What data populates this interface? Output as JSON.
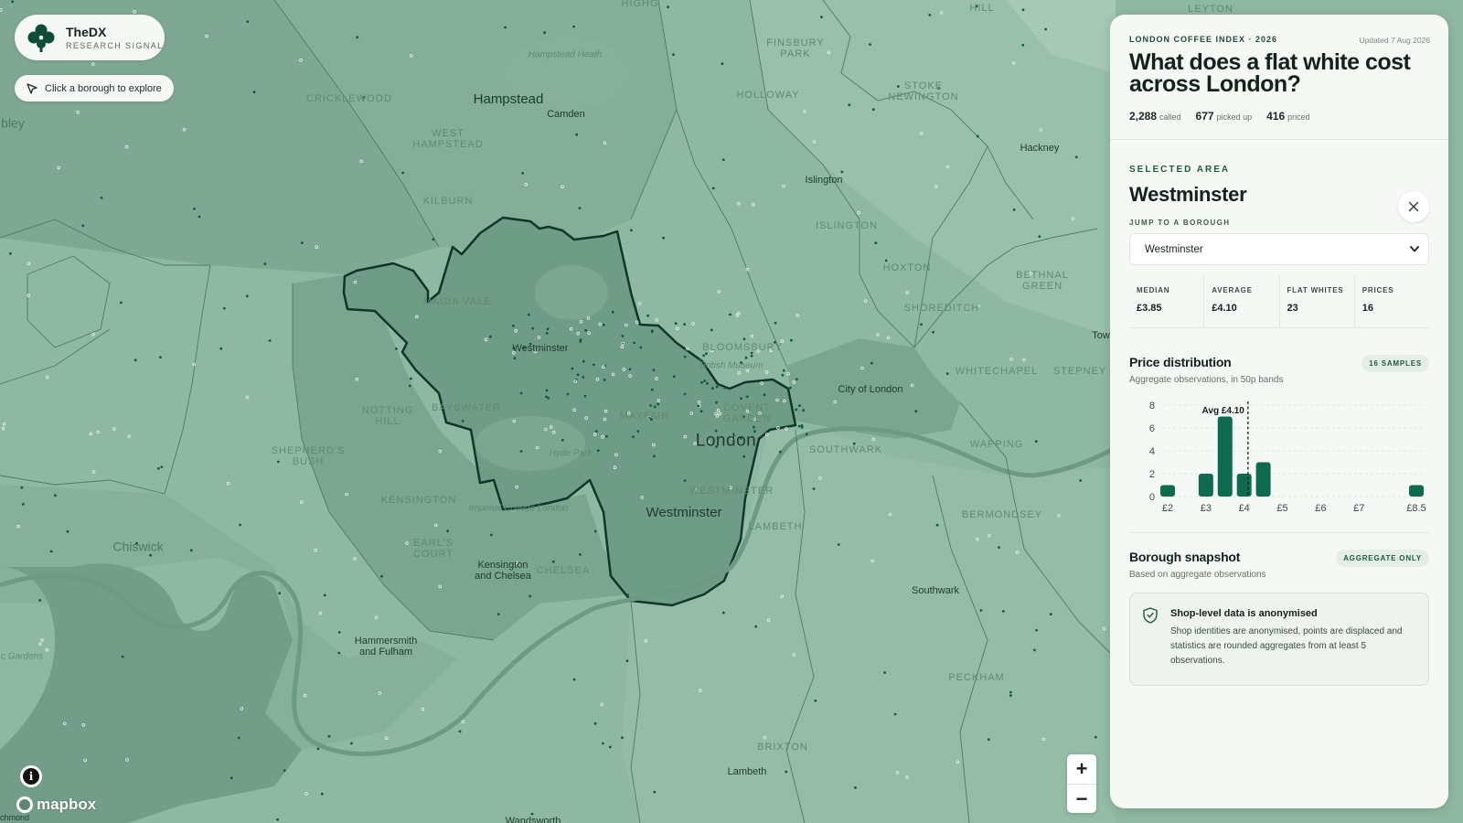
{
  "brand": {
    "name": "TheDX",
    "tagline": "RESEARCH SIGNAL"
  },
  "hint": "Click a borough to explore",
  "map": {
    "attribution": "mapbox",
    "zoom_in": "+",
    "zoom_out": "−",
    "info": "i",
    "corner_place": "chmond",
    "labels": [
      {
        "text": "Hampstead",
        "style": "med"
      },
      {
        "text": "Camden",
        "style": ""
      },
      {
        "text": "Hackney",
        "style": ""
      },
      {
        "text": "Islington",
        "style": ""
      },
      {
        "text": "Westminster",
        "style": ""
      },
      {
        "text": "City of London",
        "style": ""
      },
      {
        "text": "London",
        "style": "big"
      },
      {
        "text": "Westminster",
        "style": "med"
      },
      {
        "text": "Chiswick",
        "style": "large-faint"
      },
      {
        "text": "Kensington\nand Chelsea",
        "style": ""
      },
      {
        "text": "Hammersmith\nand Fulham",
        "style": ""
      },
      {
        "text": "Southwark",
        "style": ""
      },
      {
        "text": "Lambeth",
        "style": ""
      },
      {
        "text": "Wandsworth",
        "style": ""
      },
      {
        "text": "Tow",
        "style": ""
      },
      {
        "text": "bley",
        "style": "large-faint"
      },
      {
        "text": "HIGHG",
        "style": "faint"
      },
      {
        "text": "HILL",
        "style": "faint"
      },
      {
        "text": "LEYTON",
        "style": "faint"
      },
      {
        "text": "FINSBURY\nPARK",
        "style": "faint"
      },
      {
        "text": "STOKE\nNEWINGTON",
        "style": "faint"
      },
      {
        "text": "HOLLOWAY",
        "style": "faint"
      },
      {
        "text": "CRICKLEWOOD",
        "style": "faint"
      },
      {
        "text": "WEST\nHAMPSTEAD",
        "style": "faint"
      },
      {
        "text": "KILBURN",
        "style": "faint"
      },
      {
        "text": "ISLINGTON",
        "style": "faint"
      },
      {
        "text": "HOXTON",
        "style": "faint"
      },
      {
        "text": "BETHNAL\nGREEN",
        "style": "faint"
      },
      {
        "text": "SHOREDITCH",
        "style": "faint"
      },
      {
        "text": "MAIDA VALE",
        "style": "faint"
      },
      {
        "text": "BLOOMSBURY",
        "style": "faint"
      },
      {
        "text": "BAYSWATER",
        "style": "faint"
      },
      {
        "text": "NOTTING\nHILL",
        "style": "faint"
      },
      {
        "text": "MAYFAIR",
        "style": "faint"
      },
      {
        "text": "COVENT\nGARDEN",
        "style": "faint"
      },
      {
        "text": "WHITECHAPEL",
        "style": "faint"
      },
      {
        "text": "STEPNEY",
        "style": "faint"
      },
      {
        "text": "SOUTHWARK",
        "style": "faint"
      },
      {
        "text": "WAPPING",
        "style": "faint"
      },
      {
        "text": "SHEPHERD'S\nBUSH",
        "style": "faint"
      },
      {
        "text": "KENSINGTON",
        "style": "faint"
      },
      {
        "text": "EARL'S\nCOURT",
        "style": "faint"
      },
      {
        "text": "CHELSEA",
        "style": "faint"
      },
      {
        "text": "WESTMINSTER",
        "style": "faint"
      },
      {
        "text": "LAMBETH",
        "style": "faint"
      },
      {
        "text": "BERMONDSEY",
        "style": "faint"
      },
      {
        "text": "PECKHAM",
        "style": "faint"
      },
      {
        "text": "BRIXTON",
        "style": "faint"
      },
      {
        "text": "Hampstead Heath",
        "style": "faint-lc"
      },
      {
        "text": "Hyde Park",
        "style": "faint-lc"
      },
      {
        "text": "Imperial College London",
        "style": "faint-lc"
      },
      {
        "text": "British Museum",
        "style": "faint-lc"
      },
      {
        "text": "c Gardens",
        "style": "faint-lc"
      }
    ]
  },
  "panel": {
    "kicker": "LONDON COFFEE INDEX · 2026",
    "updated": "Updated 7 Aug 2026",
    "headline": "What does a flat white cost across London?",
    "stats": [
      {
        "value": "2,288",
        "label": "called"
      },
      {
        "value": "677",
        "label": "picked up"
      },
      {
        "value": "416",
        "label": "priced"
      }
    ],
    "selected_kicker": "SELECTED AREA",
    "area_name": "Westminster",
    "jump_label": "JUMP TO A BOROUGH",
    "jump_value": "Westminster",
    "metrics": [
      {
        "label": "MEDIAN",
        "value": "£3.85"
      },
      {
        "label": "AVERAGE",
        "value": "£4.10"
      },
      {
        "label": "FLAT WHITES",
        "value": "23"
      },
      {
        "label": "PRICES",
        "value": "16"
      }
    ],
    "distribution": {
      "title": "Price distribution",
      "badge": "16 SAMPLES",
      "subtitle": "Aggregate observations, in 50p bands"
    },
    "snapshot": {
      "title": "Borough snapshot",
      "badge": "AGGREGATE ONLY",
      "subtitle": "Based on aggregate observations",
      "notice_title": "Shop-level data is anonymised",
      "notice_text": "Shop identities are anonymised, points are displaced and statistics are rounded aggregates from at least 5 observations."
    }
  },
  "colors": {
    "accent": "#0f6b4f",
    "map_base": "#8fb8a2",
    "selected": "#6f9c86",
    "outline": "#10352a",
    "panel": "#f6f8f5"
  },
  "chart_data": {
    "type": "bar",
    "title": "Price distribution",
    "subtitle": "Aggregate observations, in 50p bands",
    "x": [
      2.0,
      3.0,
      3.5,
      4.0,
      4.5,
      8.5
    ],
    "values": [
      1,
      2,
      7,
      2,
      3,
      1
    ],
    "xticks": [
      "£2",
      "£3",
      "£4",
      "£5",
      "£6",
      "£7",
      "£8.5"
    ],
    "xtick_values": [
      2,
      3,
      4,
      5,
      6,
      7,
      8.5
    ],
    "yticks": [
      0,
      2,
      4,
      6,
      8
    ],
    "ylim": [
      0,
      8
    ],
    "xlim": [
      2,
      8.5
    ],
    "average_line": {
      "x": 4.1,
      "label": "Avg £4.10"
    },
    "grid": true,
    "bar_color": "#0f6b4f"
  }
}
